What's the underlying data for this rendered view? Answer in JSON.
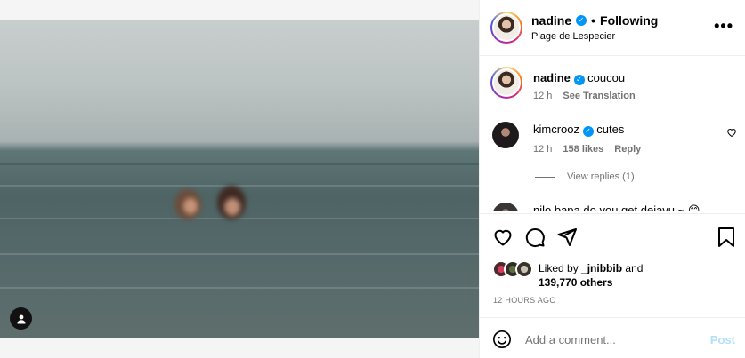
{
  "post": {
    "author": "nadine",
    "separator": "•",
    "follow_status": "Following",
    "location": "Plage de Lespecier",
    "more_glyph": "•••"
  },
  "comments": [
    {
      "username": "nadine",
      "text": "coucou",
      "time": "12 h",
      "action": "See Translation"
    },
    {
      "username": "kimcrooz",
      "text": "cutes",
      "time": "12 h",
      "likes": "158 likes",
      "action": "Reply",
      "replies": "View replies (1)"
    },
    {
      "username": "nilo.bapa",
      "text": "do you get dejavu ~ 😊"
    }
  ],
  "likes": {
    "prefix": "Liked by",
    "user": "_jnibbib",
    "conjunction": "and",
    "count": "139,770 others"
  },
  "timestamp": "12 HOURS AGO",
  "add_comment": {
    "placeholder": "Add a comment...",
    "post_label": "Post"
  },
  "colors": {
    "verified": "#0095f6",
    "muted_text": "#737373",
    "post_disabled": "#b2dffc"
  },
  "icons": [
    "user-tag-icon",
    "verified-icon",
    "more-icon",
    "heart-icon",
    "comment-icon",
    "share-icon",
    "save-icon",
    "emoji-icon"
  ]
}
